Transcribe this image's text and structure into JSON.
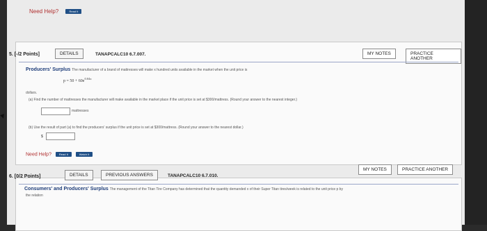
{
  "top": {
    "need_help": "Need Help?",
    "read_label": "Read It"
  },
  "q5": {
    "number": "5. [-/2 Points]",
    "details": "DETAILS",
    "code": "TANAPCALC10 6.7.007.",
    "my_notes": "MY NOTES",
    "practice": "PRACTICE ANOTHER",
    "topic_title": "Producers' Surplus",
    "topic_text": "The manufacturer of a brand of mattresses will make x hundred units available in the market when the unit price is",
    "equation": "p = 50 + 60e",
    "equation_exp": "0.04x",
    "dollars": "dollars.",
    "part_a": "(a)  Find the number of mattresses the manufacturer will make available in the market place if the unit price is set at $300/mattress. (Round your answer to the nearest integer.)",
    "part_a_unit": "mattresses",
    "part_b": "(b)  Use the result of part (a) to find the producers' surplus if the unit price is set at $300/mattress. (Round your answer to the nearest dollar.)",
    "part_b_prefix": "$",
    "need_help": "Need Help?",
    "read_label": "Read It",
    "watch_label": "Watch It"
  },
  "q6": {
    "number": "6. [0/2 Points]",
    "details": "DETAILS",
    "previous": "PREVIOUS ANSWERS",
    "code": "TANAPCALC10 6.7.010.",
    "my_notes": "MY NOTES",
    "practice": "PRACTICE ANOTHER",
    "topic_title": "Consumers' and Producers' Surplus",
    "topic_text": "The management of the Titan Tire Company has determined that the quantity demanded x of their Super Titan tires/week is related to the unit price p by",
    "topic_text2": "the relation"
  }
}
